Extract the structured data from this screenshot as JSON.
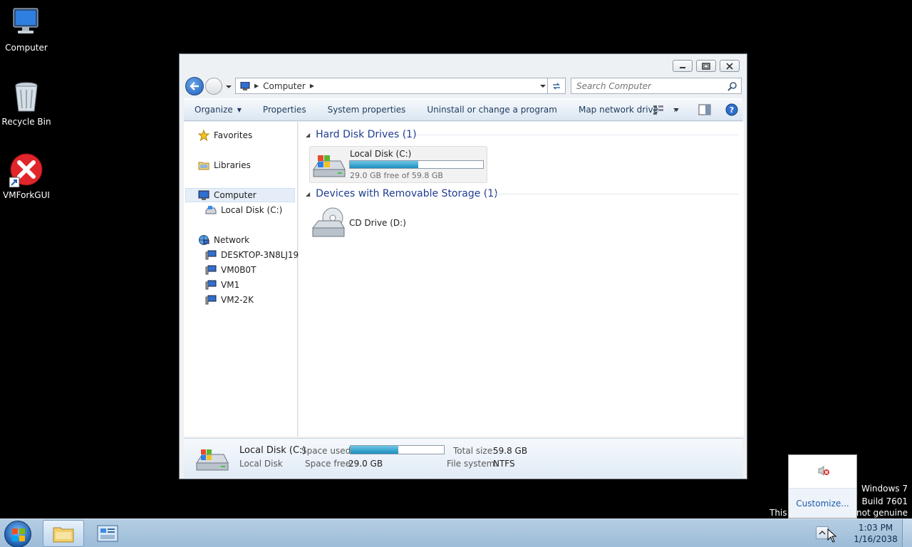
{
  "desktop": {
    "icons": [
      {
        "label": "Computer"
      },
      {
        "label": "Recycle Bin"
      },
      {
        "label": "VMForkGUI"
      }
    ]
  },
  "window": {
    "address": {
      "path": "Computer"
    },
    "search": {
      "placeholder": "Search Computer"
    },
    "commands": {
      "organize": "Organize",
      "properties": "Properties",
      "system_properties": "System properties",
      "uninstall": "Uninstall or change a program",
      "map_drive": "Map network drive",
      "more": "»"
    },
    "nav": {
      "favorites": "Favorites",
      "libraries": "Libraries",
      "computer": "Computer",
      "local_disk": "Local Disk (C:)",
      "network": "Network",
      "hosts": [
        "DESKTOP-3N8LJ19",
        "VM0B0T",
        "VM1",
        "VM2-2K"
      ]
    },
    "groups": {
      "hdd_header": "Hard Disk Drives (1)",
      "removable_header": "Devices with Removable Storage (1)"
    },
    "drives": {
      "c_name": "Local Disk (C:)",
      "c_free_text": "29.0 GB free of 59.8 GB",
      "c_used_fraction": 0.515,
      "d_name": "CD Drive (D:)"
    },
    "details": {
      "name": "Local Disk (C:)",
      "type": "Local Disk",
      "space_used_label": "Space used:",
      "space_free_label": "Space free:",
      "space_free_value": "29.0 GB",
      "total_size_label": "Total size:",
      "total_size_value": "59.8 GB",
      "file_system_label": "File system:",
      "file_system_value": "NTFS"
    }
  },
  "tray_popup": {
    "customize": "Customize..."
  },
  "watermark": {
    "line1": "Windows 7",
    "line2": "Build 7601",
    "line3_left": "This",
    "line3_right": "s not genuine"
  },
  "taskbar": {
    "time": "1:03 PM",
    "date": "1/16/2038"
  },
  "colors": {
    "accent": "#1b8fbf",
    "link": "#1e3d8f"
  }
}
